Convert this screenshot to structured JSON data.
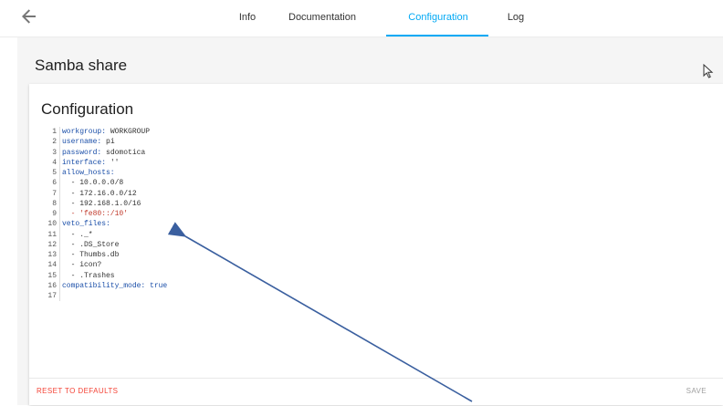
{
  "nav": {
    "tabs": [
      {
        "label": "Info"
      },
      {
        "label": "Documentation"
      },
      {
        "label": "Configuration"
      },
      {
        "label": "Log"
      }
    ]
  },
  "page": {
    "title": "Samba share"
  },
  "card": {
    "title": "Configuration",
    "lines": [
      {
        "n": "1",
        "key": "workgroup:",
        "val": " WORKGROUP",
        "kind": "v"
      },
      {
        "n": "2",
        "key": "username:",
        "val": " pi",
        "kind": "v"
      },
      {
        "n": "3",
        "key": "password:",
        "val": " sdomotica",
        "kind": "v"
      },
      {
        "n": "4",
        "key": "interface:",
        "val": " ''",
        "kind": "v"
      },
      {
        "n": "5",
        "key": "allow_hosts:",
        "val": "",
        "kind": "v"
      },
      {
        "n": "6",
        "key": "",
        "val": "  - 10.0.0.0/8",
        "kind": "v"
      },
      {
        "n": "7",
        "key": "",
        "val": "  - 172.16.0.0/12",
        "kind": "v"
      },
      {
        "n": "8",
        "key": "",
        "val": "  - 192.168.1.0/16",
        "kind": "v"
      },
      {
        "n": "9",
        "key": "",
        "val": "  - 'fe80::/10'",
        "kind": "s"
      },
      {
        "n": "10",
        "key": "veto_files:",
        "val": "",
        "kind": "v"
      },
      {
        "n": "11",
        "key": "",
        "val": "  - ._*",
        "kind": "v"
      },
      {
        "n": "12",
        "key": "",
        "val": "  - .DS_Store",
        "kind": "v"
      },
      {
        "n": "13",
        "key": "",
        "val": "  - Thumbs.db",
        "kind": "v"
      },
      {
        "n": "14",
        "key": "",
        "val": "  - icon?",
        "kind": "v"
      },
      {
        "n": "15",
        "key": "",
        "val": "  - .Trashes",
        "kind": "v"
      },
      {
        "n": "16",
        "key": "compatibility_mode:",
        "val": " true",
        "kind": "k"
      },
      {
        "n": "17",
        "key": "",
        "val": "",
        "kind": "v"
      }
    ],
    "reset_label": "RESET TO DEFAULTS",
    "save_label": "SAVE"
  },
  "colors": {
    "accent": "#03a9f4",
    "danger": "#f44336",
    "key": "#1a4ea8",
    "string": "#c0392b",
    "annotation_arrow": "#3a5f9f"
  },
  "icons": {
    "back": "arrow-left-icon",
    "cursor": "mouse-pointer-icon",
    "annotation": "annotation-arrow"
  }
}
